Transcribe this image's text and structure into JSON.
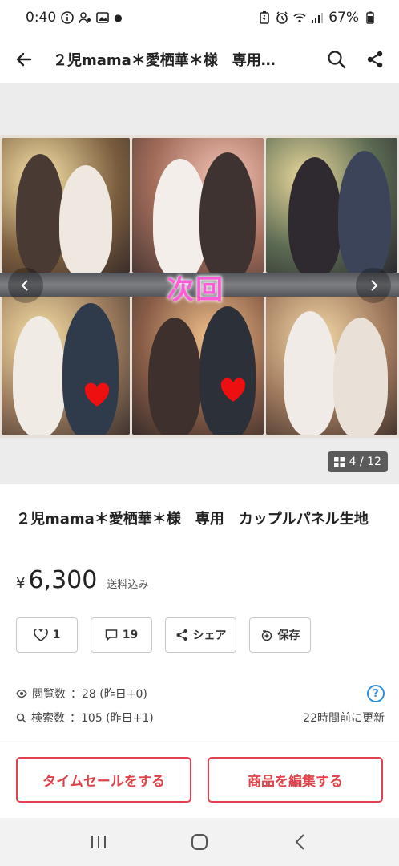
{
  "status": {
    "time": "0:40",
    "battery": "67%"
  },
  "appbar": {
    "title": "２児mama＊愛栖華＊様　専用…"
  },
  "gallery": {
    "overlay_text": "次回",
    "counter": "4 / 12"
  },
  "item": {
    "title": "２児mama＊愛栖華＊様　専用　カップルパネル生地",
    "currency": "¥",
    "price": "6,300",
    "shipping": "送料込み"
  },
  "actions": {
    "like_count": "1",
    "comment_count": "19",
    "share_label": "シェア",
    "save_label": "保存"
  },
  "stats": {
    "views_label": "閲覧数",
    "views_value": "：28 (昨日+0)",
    "search_label": "検索数",
    "search_value": "：105 (昨日+1)",
    "updated": "22時間前に更新"
  },
  "buttons": {
    "time_sale": "タイムセールをする",
    "edit_item": "商品を編集する"
  },
  "colors": {
    "accent": "#e0414a",
    "overlay_text": "#ff5bd6",
    "help": "#2f8fd8"
  }
}
